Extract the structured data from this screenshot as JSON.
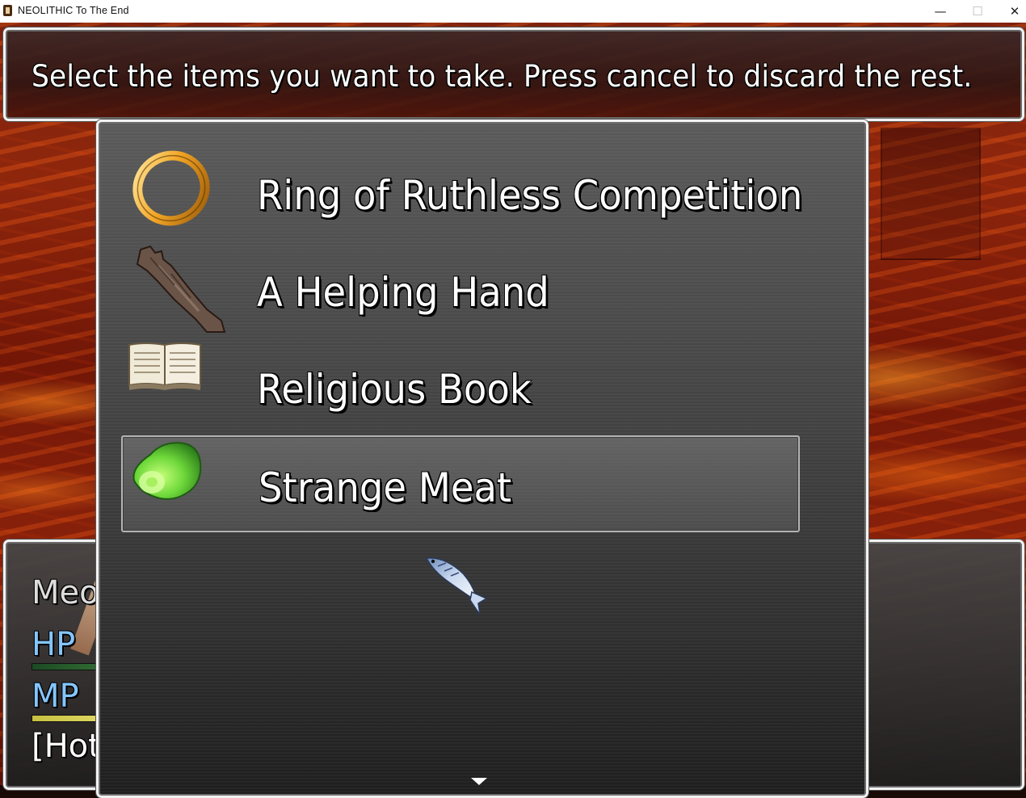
{
  "window": {
    "title": "NEOLITHIC To The End",
    "minimize_glyph": "—",
    "maximize_glyph": "☐",
    "close_glyph": "✕"
  },
  "help": {
    "text": "Select the items you want to take. Press cancel to discard the rest."
  },
  "items": [
    {
      "label": "Ring of Ruthless Competition",
      "icon": "gold-ring-icon",
      "selected": false
    },
    {
      "label": "A Helping Hand",
      "icon": "severed-arm-icon",
      "selected": false
    },
    {
      "label": "Religious Book",
      "icon": "open-book-icon",
      "selected": false
    },
    {
      "label": "Strange Meat",
      "icon": "green-meat-icon",
      "selected": true
    }
  ],
  "follower_icon": "fish-icon",
  "status": {
    "name": "Meov",
    "hp_label": "HP",
    "mp_label": "MP",
    "state": "[Hot",
    "colors": {
      "hp_gauge": "#3a7a3a",
      "mp_gauge": "#e8e070",
      "stat_label": "#84c6ff"
    }
  },
  "colors": {
    "window_border": "#f2f2f2",
    "text": "#ffffff",
    "lava": "#a0300f"
  }
}
